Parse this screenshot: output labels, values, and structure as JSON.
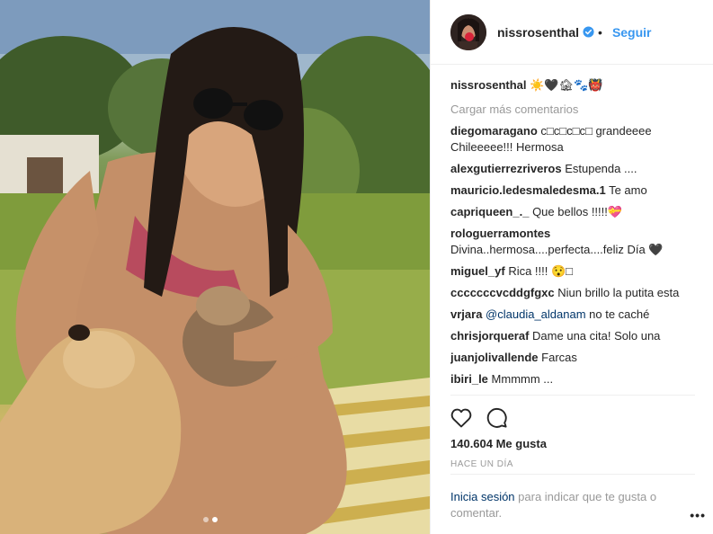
{
  "post": {
    "author": "nissrosenthal",
    "follow_label": "Seguir",
    "bullet": "•",
    "caption_text": "☀️🖤🏚🐾👹",
    "load_more": "Cargar más comentarios",
    "comments": [
      {
        "user": "diegomaragano",
        "text": "c□c□c□c□ grandeeee Chileeeee!!! Hermosa"
      },
      {
        "user": "alexgutierrezriveros",
        "text": "Estupenda ...."
      },
      {
        "user": "mauricio.ledesmaledesma.1",
        "text": "Te amo"
      },
      {
        "user": "capriqueen_._",
        "text": "Que bellos !!!!!💝"
      },
      {
        "user": "rologuerramontes",
        "text": "Divina..hermosa....perfecta....feliz Día 🖤"
      },
      {
        "user": "miguel_yf",
        "text": "Rica !!!! 😯□"
      },
      {
        "user": "cccccccvcddgfgxc",
        "text": "Niun brillo la putita esta"
      },
      {
        "user": "vrjara",
        "mention": "@claudia_aldanam",
        "text": " no te caché"
      },
      {
        "user": "chrisjorqueraf",
        "text": "Dame una cita! Solo una"
      },
      {
        "user": "juanjolivallende",
        "text": "Farcas"
      },
      {
        "user": "ibiri_le",
        "text": "Mmmmm ..."
      }
    ],
    "likes": "140.604 Me gusta",
    "time_ago": "Hace un día",
    "login_link": "Inicia sesión",
    "login_text": " para indicar que te gusta o comentar.",
    "more_options": "•••",
    "carousel": {
      "count": 2,
      "active_index": 1
    }
  },
  "icons": {
    "verified": "verified-badge-icon",
    "like": "heart-icon",
    "comment": "comment-bubble-icon",
    "more": "more-options-icon"
  },
  "colors": {
    "accent": "#3897f0",
    "link": "#003569",
    "muted": "#999999",
    "text": "#262626",
    "border": "#efefef"
  }
}
